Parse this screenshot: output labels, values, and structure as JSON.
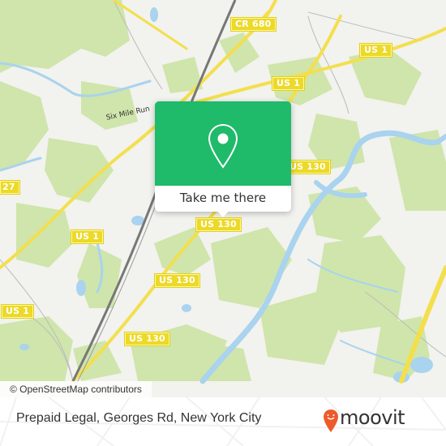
{
  "map": {
    "colors": {
      "background": "#f2f2ee",
      "wood": "#cfe5ab",
      "water": "#a9d3ee",
      "road": "#f3df4d",
      "railway": "#777777",
      "shield": "#ecd928",
      "brand_green": "#1fba6a",
      "moovit_orange": "#ee5a2b"
    },
    "road_labels": [
      {
        "id": "cr680",
        "text": "CR 680"
      },
      {
        "id": "us1-north-east",
        "text": "US 1"
      },
      {
        "id": "us1-north",
        "text": "US 1"
      },
      {
        "id": "us130-east",
        "text": "US 130"
      },
      {
        "id": "rt27",
        "text": "27"
      },
      {
        "id": "us1-west",
        "text": "US 1"
      },
      {
        "id": "us130-center",
        "text": "US 130"
      },
      {
        "id": "us130-south",
        "text": "US 130"
      },
      {
        "id": "us1-south-west",
        "text": "US 1"
      },
      {
        "id": "us130-far-south",
        "text": "US 130"
      }
    ],
    "water_labels": [
      {
        "text": "Six Mile Run"
      }
    ],
    "attribution": "© OpenStreetMap contributors"
  },
  "popup": {
    "icon": "map-pin-icon",
    "button_label": "Take me there"
  },
  "footer": {
    "place_title": "Prepaid Legal, Georges Rd, New York City",
    "brand_icon": "moovit-pin-icon",
    "brand_name": "moovit"
  }
}
